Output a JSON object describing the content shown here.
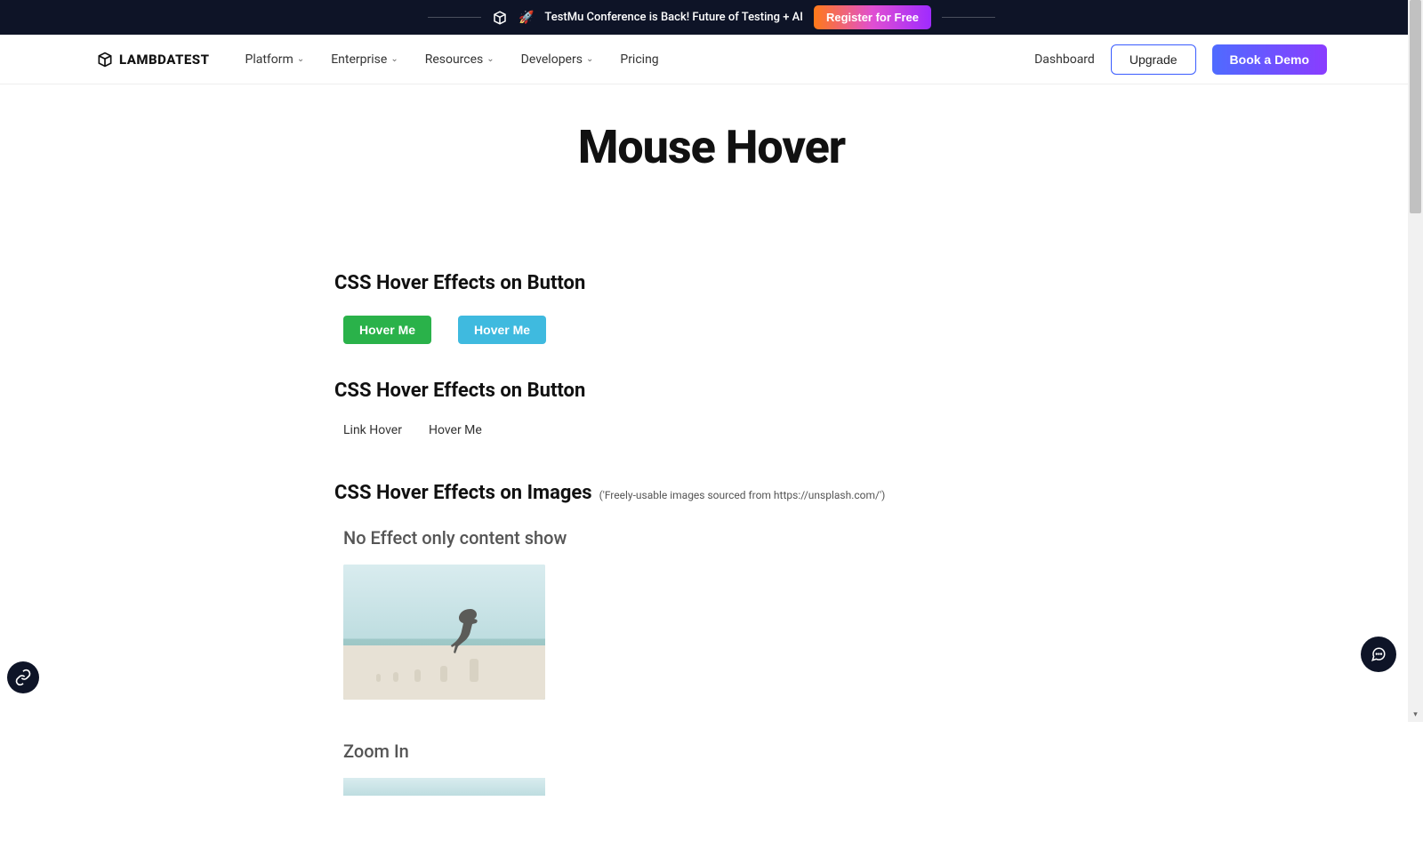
{
  "banner": {
    "text": "TestMu Conference is Back! Future of Testing + AI",
    "cta": "Register for Free",
    "emoji": "🚀"
  },
  "brand": {
    "name": "LAMBDATEST"
  },
  "nav": {
    "items": [
      {
        "label": "Platform",
        "hasMenu": true
      },
      {
        "label": "Enterprise",
        "hasMenu": true
      },
      {
        "label": "Resources",
        "hasMenu": true
      },
      {
        "label": "Developers",
        "hasMenu": true
      },
      {
        "label": "Pricing",
        "hasMenu": false
      }
    ],
    "dashboard": "Dashboard",
    "upgrade": "Upgrade",
    "book_demo": "Book a Demo"
  },
  "page": {
    "title": "Mouse Hover",
    "sections": {
      "buttons_heading": "CSS Hover Effects on Button",
      "hover_btn_1": "Hover Me",
      "hover_btn_2": "Hover Me",
      "links_heading": "CSS Hover Effects on Button",
      "link_1": "Link Hover",
      "link_2": "Hover Me",
      "images_heading": "CSS Hover Effects on Images",
      "images_note": "('Freely-usable images sourced from https://unsplash.com/')",
      "img_sub_1": "No Effect only content show",
      "img_sub_2": "Zoom In"
    }
  }
}
